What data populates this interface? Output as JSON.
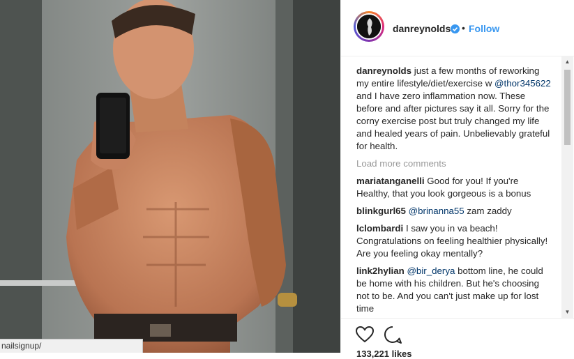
{
  "post": {
    "username": "danreynolds",
    "separator": "•",
    "follow_label": "Follow",
    "caption": {
      "text_1": " just a few months of reworking my entire lifestyle/diet/exercise w ",
      "mention": "@thor345622",
      "text_2": " and I have zero inflammation now. These before and after pictures say it all. Sorry for the corny exercise post but truly changed my life and healed years of pain. Unbelievably grateful for health."
    },
    "load_more_label": "Load more comments",
    "comments": [
      {
        "user": "mariatanganelli",
        "mention": "",
        "text": " Good for you! If you're Healthy, that you look gorgeous is a bonus"
      },
      {
        "user": "blinkgurl65",
        "mention": "@brinanna55",
        "text": " zam zaddy"
      },
      {
        "user": "lclombardi",
        "mention": "",
        "text": " I saw you in va beach! Congratulations on feeling healthier physically! Are you feeling okay mentally?"
      },
      {
        "user": "link2hylian",
        "mention": "@bir_derya",
        "text": " bottom line, he could be home with his children. But he's choosing not to be. And you can't just make up for lost time"
      }
    ],
    "likes_label": "133,221 likes"
  },
  "status_bar": {
    "url": "nailsignup/"
  },
  "icons": {
    "verified": "verified-badge-icon",
    "like": "heart-icon",
    "comment": "comment-bubble-icon"
  },
  "colors": {
    "link": "#3897f0",
    "mention": "#003569",
    "muted": "#999999"
  }
}
